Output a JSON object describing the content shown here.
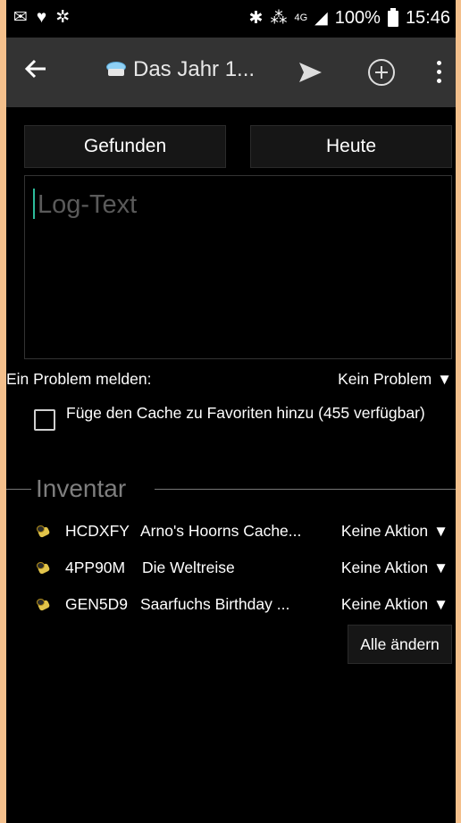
{
  "status_bar": {
    "left_icons": [
      "mail-icon",
      "heart-icon",
      "pinwheel-icon"
    ],
    "network_label": "4G",
    "battery_percent": "100%",
    "time": "15:46"
  },
  "toolbar": {
    "back_icon": "arrow-left-icon",
    "title": "Das Jahr 1...",
    "cache_icon": "cache-icon",
    "send_icon": "send-icon",
    "add_icon": "add-circle-icon",
    "more_icon": "more-vert-icon"
  },
  "log": {
    "type_button": "Gefunden",
    "date_button": "Heute",
    "placeholder": "Log-Text",
    "value": ""
  },
  "problem": {
    "label": "Ein Problem melden:",
    "value": "Kein Problem"
  },
  "favorites": {
    "label": "Füge den Cache zu Favoriten hinzu (455 verfügbar)",
    "checked": false
  },
  "inventory": {
    "title": "Inventar",
    "items": [
      {
        "code": "HCDXFY",
        "name": "Arno's Hoorns Cache...",
        "action": "Keine Aktion"
      },
      {
        "code": "4PP90M",
        "name": "Die Weltreise",
        "action": "Keine Aktion"
      },
      {
        "code": "GEN5D9",
        "name": "Saarfuchs Birthday ...",
        "action": "Keine Aktion"
      }
    ],
    "change_all_button": "Alle ändern"
  },
  "colors": {
    "background": "#000000",
    "toolbar": "#333333",
    "accent_cursor": "#2dbb9b",
    "frame": "#f4c08c"
  }
}
